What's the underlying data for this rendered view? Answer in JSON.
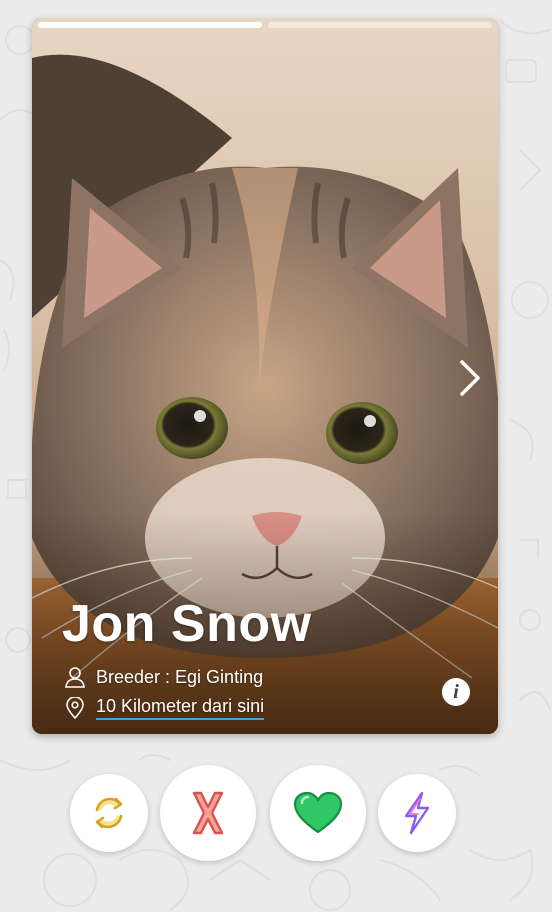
{
  "card": {
    "name": "Jon Snow",
    "breeder": "Breeder : Egi Ginting",
    "distance": "10 Kilometer dari sini",
    "photo_count": 2,
    "active_photo": 1,
    "photo_subject": "tabby-cat-photo"
  },
  "icons": {
    "breeder": "person-icon",
    "distance": "location-pin-icon",
    "info": "info-icon",
    "next": "chevron-right-icon"
  },
  "actions": [
    {
      "name": "rewind-button",
      "icon": "rewind-icon",
      "color": "#e8b923"
    },
    {
      "name": "nope-button",
      "icon": "x-icon",
      "color": "#e0625c"
    },
    {
      "name": "like-button",
      "icon": "heart-icon",
      "color": "#2ec866"
    },
    {
      "name": "boost-button",
      "icon": "lightning-icon",
      "color": "#9b6cf0"
    }
  ],
  "colors": {
    "background": "#ebebeb",
    "link_underline": "#3da5e0"
  }
}
